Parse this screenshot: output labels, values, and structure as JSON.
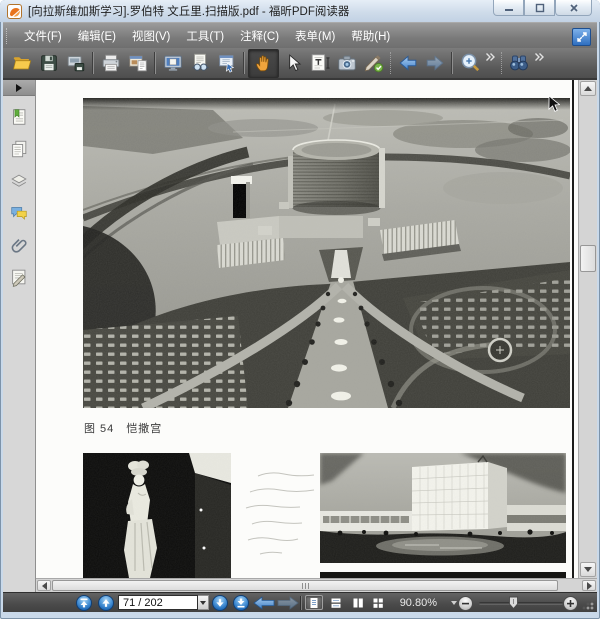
{
  "window": {
    "title": "[向拉斯维加斯学习].罗伯特 文丘里.扫描版.pdf - 福昕PDF阅读器",
    "controls": [
      "minimize",
      "restore",
      "close"
    ]
  },
  "menu_bar": {
    "items": [
      {
        "label": "文件(F)"
      },
      {
        "label": "编辑(E)"
      },
      {
        "label": "视图(V)"
      },
      {
        "label": "工具(T)"
      },
      {
        "label": "注释(C)"
      },
      {
        "label": "表单(M)"
      },
      {
        "label": "帮助(H)"
      }
    ],
    "expand_button": "toolbar-expand"
  },
  "toolbar": {
    "buttons": [
      "open",
      "save",
      "save-as",
      "print",
      "print-preview",
      "fit-screen",
      "read-mode",
      "reflow",
      "hand-tool",
      "select-tool",
      "select-text",
      "snapshot",
      "sign",
      "previous-view",
      "next-view",
      "zoom-in",
      "find"
    ],
    "active_tool": "hand-tool"
  },
  "sidebar": {
    "panels": [
      "bookmarks",
      "pages",
      "layers",
      "comments",
      "attachments",
      "signature"
    ]
  },
  "document": {
    "figure_caption": "图 54　恺撒宫",
    "figures": [
      "caesars-palace-aerial-photo",
      "statue-photo",
      "hotel-pool-photo"
    ]
  },
  "status_bar": {
    "page_field": "71 / 202",
    "page_current": "71",
    "page_total": "202",
    "zoom_level": "90.80%",
    "view_modes": [
      "single-page",
      "continuous",
      "facing",
      "continuous-facing"
    ],
    "active_view_mode": "single-page"
  },
  "colors": {
    "titlebar": "#d7e3f0",
    "menubar": "#7f7f7f",
    "toolbar": "#5f5f5f",
    "statusbar": "#4a4a4a",
    "accent_blue": "#2d79c8",
    "hand_orange": "#f0a43c"
  }
}
